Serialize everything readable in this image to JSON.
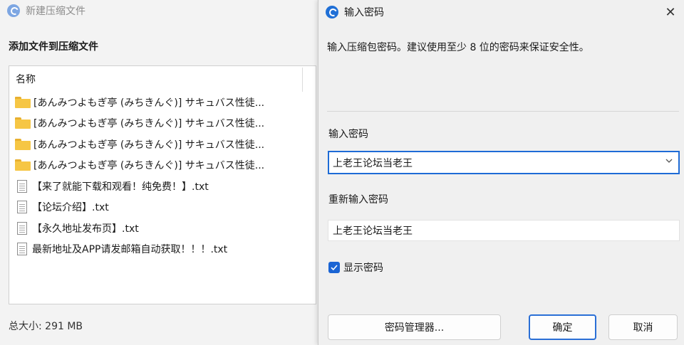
{
  "background_window": {
    "title": "新建压缩文件",
    "heading": "添加文件到压缩文件",
    "column_name": "名称",
    "items": [
      {
        "type": "folder",
        "label": "[あんみつよもぎ亭 (みちきんぐ)] サキュバス性徒..."
      },
      {
        "type": "folder",
        "label": "[あんみつよもぎ亭 (みちきんぐ)] サキュバス性徒..."
      },
      {
        "type": "folder",
        "label": "[あんみつよもぎ亭 (みちきんぐ)] サキュバス性徒..."
      },
      {
        "type": "folder",
        "label": "[あんみつよもぎ亭 (みちきんぐ)] サキュバス性徒..."
      },
      {
        "type": "file",
        "label": "【来了就能下载和观看！纯免费！】.txt"
      },
      {
        "type": "file",
        "label": "【论坛介绍】.txt"
      },
      {
        "type": "file",
        "label": "【永久地址发布页】.txt"
      },
      {
        "type": "file",
        "label": "最新地址及APP请发邮箱自动获取！！！.txt"
      }
    ],
    "total_size": "总大小: 291 MB"
  },
  "dialog": {
    "title": "输入密码",
    "description": "输入压缩包密码。建议使用至少 8 位的密码来保证安全性。",
    "password_label": "输入密码",
    "password_value": "上老王论坛当老王",
    "confirm_label": "重新输入密码",
    "confirm_value": "上老王论坛当老王",
    "show_password_label": "显示密码",
    "show_password_checked": true,
    "manager_button": "密码管理器...",
    "ok_button": "确定",
    "cancel_button": "取消",
    "close_glyph": "✕"
  },
  "colors": {
    "accent": "#1e6bd6",
    "folder": "#f6c644"
  }
}
